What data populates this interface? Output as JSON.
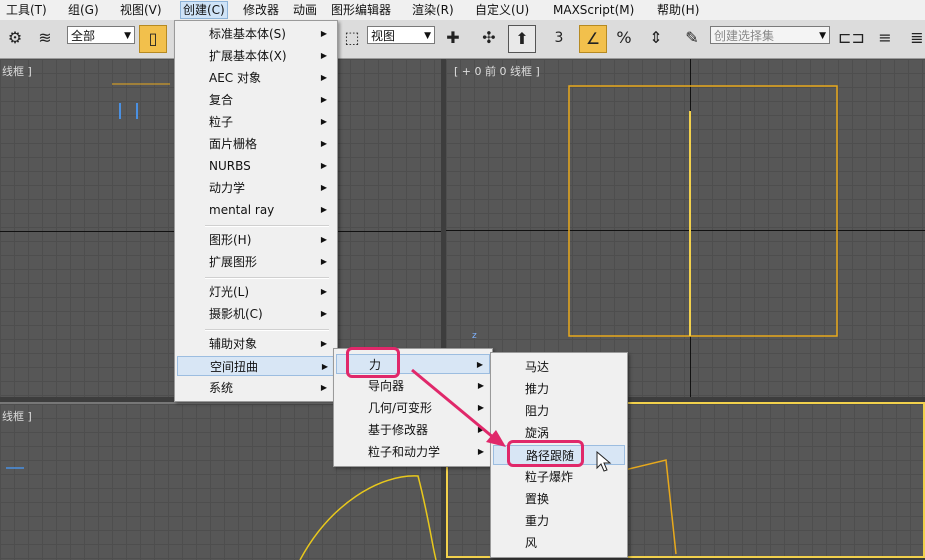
{
  "menubar": {
    "items": [
      "工具(T)",
      "组(G)",
      "视图(V)",
      "创建(C)",
      "修改器",
      "动画",
      "图形编辑器",
      "渲染(R)",
      "自定义(U)",
      "MAXScript(M)",
      "帮助(H)"
    ]
  },
  "toolbar": {
    "filter_select": "全部",
    "coord_select": "视图",
    "angle_snap_label": "3",
    "selection_set_placeholder": "创建选择集"
  },
  "viewports": {
    "top_left_label": "线框 ]",
    "front_label": "[ + 0 前 0 线框 ]",
    "bottom_left_label": "线框 ]",
    "axis_z_label": "z"
  },
  "create_menu": {
    "items": [
      {
        "label": "标准基本体(S)",
        "sub": true
      },
      {
        "label": "扩展基本体(X)",
        "sub": true
      },
      {
        "label": "AEC 对象",
        "sub": true
      },
      {
        "label": "复合",
        "sub": true
      },
      {
        "label": "粒子",
        "sub": true
      },
      {
        "label": "面片栅格",
        "sub": true
      },
      {
        "label": "NURBS",
        "sub": true
      },
      {
        "label": "动力学",
        "sub": true
      },
      {
        "label": "mental ray",
        "sub": true
      },
      {
        "label": "图形(H)",
        "sub": true
      },
      {
        "label": "扩展图形",
        "sub": true
      },
      {
        "label": "灯光(L)",
        "sub": true
      },
      {
        "label": "摄影机(C)",
        "sub": true
      },
      {
        "label": "辅助对象",
        "sub": true
      },
      {
        "label": "空间扭曲",
        "sub": true
      },
      {
        "label": "系统",
        "sub": true
      }
    ]
  },
  "spacewarp_menu": {
    "items": [
      "力",
      "导向器",
      "几何/可变形",
      "基于修改器",
      "粒子和动力学"
    ]
  },
  "force_menu": {
    "items": [
      "马达",
      "推力",
      "阻力",
      "旋涡",
      "路径跟随",
      "粒子爆炸",
      "置换",
      "重力",
      "风"
    ]
  },
  "colors": {
    "accent": "#e0286a",
    "highlight": "#f2c04c",
    "object_yellow": "#e8a91c"
  },
  "icons": [
    "select-object-icon",
    "pivot-icon",
    "snap-toggle-icon",
    "mirror-icon",
    "align-icon",
    "cursor-arrow-icon"
  ]
}
